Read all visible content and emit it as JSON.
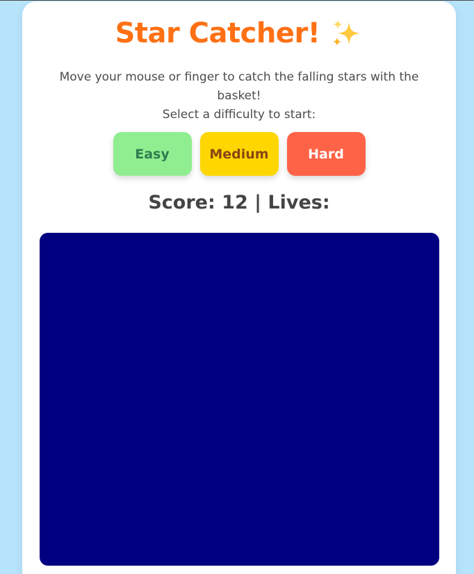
{
  "app": {
    "title": "Star Catcher!",
    "title_icon": "sparkles-icon",
    "accent_color": "#ff7014"
  },
  "instructions": {
    "line1": "Move your mouse or finger to catch the falling stars with the basket!",
    "line2": "Select a difficulty to start:"
  },
  "difficulty": {
    "buttons": [
      {
        "label": "Easy",
        "color": "#90ee90"
      },
      {
        "label": "Medium",
        "color": "#ffd700"
      },
      {
        "label": "Hard",
        "color": "#ff6347"
      }
    ]
  },
  "status": {
    "score_label": "Score:",
    "score_value": "12",
    "separator": "|",
    "lives_label": "Lives:"
  },
  "game": {
    "background_color": "#000080"
  }
}
